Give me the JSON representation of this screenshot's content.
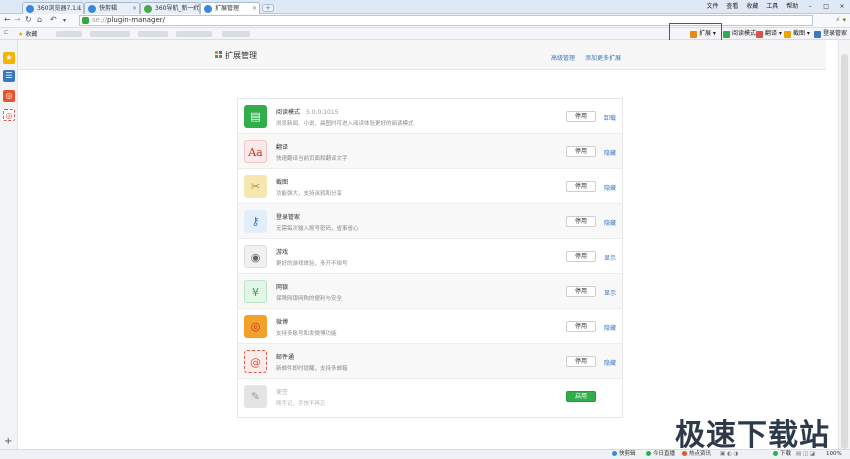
{
  "browser": {
    "tabs": [
      {
        "label": "360浏览器7.1.1",
        "icon": "globe-icon",
        "color": "#3c88d8",
        "active": false
      },
      {
        "label": "快剪辑",
        "icon": "scissors-icon",
        "color": "#3c88d8",
        "active": false
      },
      {
        "label": "360导航_新一代",
        "icon": "360-icon",
        "color": "#4aa84a",
        "active": false
      },
      {
        "label": "扩展管理",
        "icon": "extension-icon",
        "color": "#3c88d8",
        "active": true
      }
    ],
    "new_tab_label": "+",
    "menus": [
      "文件",
      "查看",
      "收藏",
      "工具",
      "帮助"
    ],
    "address": {
      "scheme": "se://",
      "path": "plugin-manager/"
    },
    "favorites_label": "收藏"
  },
  "toolbar_extensions": [
    {
      "label": "扩展",
      "icon": "grid-icon",
      "color": "#e88a1a"
    },
    {
      "label": "阅读模式",
      "icon": "book-icon",
      "color": "#2fae4a"
    },
    {
      "label": "翻译",
      "icon": "translate-icon",
      "color": "#d9534f"
    },
    {
      "label": "截图",
      "icon": "screenshot-icon",
      "color": "#e8a400"
    },
    {
      "label": "登录管家",
      "icon": "key-icon",
      "color": "#3a78c3"
    }
  ],
  "page": {
    "title": "扩展管理",
    "links": [
      "高级管理",
      "添加更多扩展"
    ]
  },
  "extensions": [
    {
      "name": "阅读模式",
      "version": "5.0.0.1015",
      "desc": "浏览新闻、小说、晨图时可进入阅读体验更好的阅读模式",
      "toggle": "停用",
      "action": "卸载",
      "icon": "book-icon",
      "icon_bg": "#2fae4a",
      "icon_glyph": "▤",
      "glyph_color": "#ffffff",
      "enabled": true
    },
    {
      "name": "翻译",
      "version": "",
      "desc": "快速翻译当前页面和翻译文字",
      "toggle": "停用",
      "action": "隐藏",
      "icon": "translate-icon",
      "icon_bg": "#fbe9e8",
      "icon_glyph": "Aa",
      "glyph_color": "#c9302c",
      "enabled": true
    },
    {
      "name": "截图",
      "version": "",
      "desc": "功能强大，支持涂鸦和分享",
      "toggle": "停用",
      "action": "隐藏",
      "icon": "scissors-icon",
      "icon_bg": "#f6e7b0",
      "icon_glyph": "✂",
      "glyph_color": "#b5892b",
      "enabled": true
    },
    {
      "name": "登录管家",
      "version": "",
      "desc": "无需每次输入账号密码，省事省心",
      "toggle": "停用",
      "action": "隐藏",
      "icon": "key-icon",
      "icon_bg": "#e2effb",
      "icon_glyph": "⚷",
      "glyph_color": "#3a78c3",
      "enabled": true
    },
    {
      "name": "游戏",
      "version": "",
      "desc": "更好的游戏体验，多开不掉号",
      "toggle": "停用",
      "action": "显示",
      "icon": "gamepad-icon",
      "icon_bg": "#f1f1f1",
      "icon_glyph": "◉",
      "glyph_color": "#666666",
      "enabled": true
    },
    {
      "name": "网银",
      "version": "",
      "desc": "保障网银网购的便利与安全",
      "toggle": "停用",
      "action": "显示",
      "icon": "shield-icon",
      "icon_bg": "#e3f5e6",
      "icon_glyph": "¥",
      "glyph_color": "#2fae4a",
      "enabled": true
    },
    {
      "name": "微博",
      "version": "",
      "desc": "支持多账号和发微博功能",
      "toggle": "停用",
      "action": "隐藏",
      "icon": "weibo-icon",
      "icon_bg": "#f2a12a",
      "icon_glyph": "◎",
      "glyph_color": "#c9302c",
      "enabled": true
    },
    {
      "name": "邮件通",
      "version": "",
      "desc": "新邮件即时提醒，支持多邮箱",
      "toggle": "停用",
      "action": "隐藏",
      "icon": "mail-icon",
      "icon_bg": "#fdecea",
      "icon_glyph": "@",
      "glyph_color": "#d9534f",
      "enabled": true
    },
    {
      "name": "便签",
      "version": "",
      "desc": "随手记，手快不再忘",
      "toggle": "启用",
      "action": "",
      "icon": "note-icon",
      "icon_bg": "#e4e4e4",
      "icon_glyph": "✎",
      "glyph_color": "#9a9a9a",
      "enabled": false
    }
  ],
  "sidebar": [
    {
      "icon": "star-icon",
      "color": "#f5b400",
      "glyph": "★"
    },
    {
      "icon": "list-icon",
      "color": "#3a78c3",
      "glyph": "☰"
    },
    {
      "icon": "weibo-icon",
      "color": "#e8522c",
      "glyph": "◎"
    },
    {
      "icon": "target-icon",
      "color": "#ffffff",
      "glyph": "◎"
    }
  ],
  "statusbar": {
    "items": [
      "快剪辑",
      "今日直播",
      "热点资讯",
      "下载",
      "100%"
    ]
  },
  "watermark": "极速下载站"
}
